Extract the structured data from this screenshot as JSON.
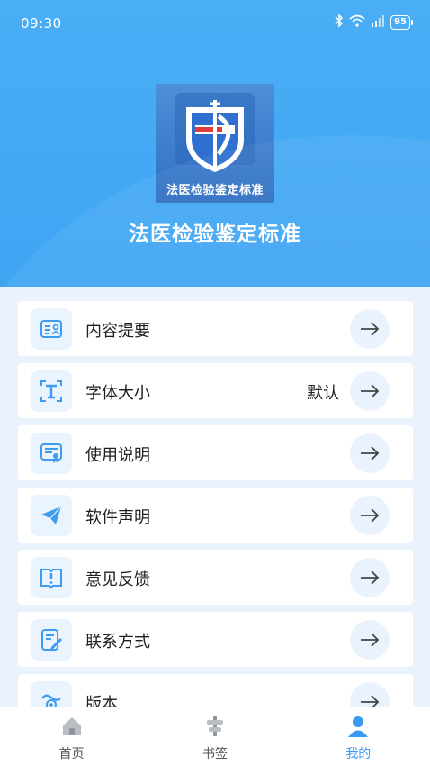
{
  "status_bar": {
    "time": "09:30",
    "battery": "95"
  },
  "app": {
    "logo_caption": "法医检验鉴定标准",
    "title": "法医检验鉴定标准"
  },
  "menu": {
    "items": [
      {
        "label": "内容提要",
        "value": "",
        "icon": "contact-card-icon"
      },
      {
        "label": "字体大小",
        "value": "默认",
        "icon": "text-size-icon"
      },
      {
        "label": "使用说明",
        "value": "",
        "icon": "certificate-icon"
      },
      {
        "label": "软件声明",
        "value": "",
        "icon": "paper-plane-icon"
      },
      {
        "label": "意见反馈",
        "value": "",
        "icon": "feedback-book-icon"
      },
      {
        "label": "联系方式",
        "value": "",
        "icon": "contact-edit-icon"
      },
      {
        "label": "版本....",
        "value": "",
        "icon": "version-icon"
      }
    ]
  },
  "tabbar": {
    "tabs": [
      {
        "label": "首页",
        "icon": "home-icon",
        "active": false
      },
      {
        "label": "书签",
        "icon": "bookmark-icon",
        "active": false
      },
      {
        "label": "我的",
        "icon": "user-icon",
        "active": true
      }
    ]
  },
  "colors": {
    "accent": "#3a9af0",
    "header_bg": "#45abf5",
    "page_bg": "#eaf3fd",
    "icon_blue": "#3d9bf0"
  }
}
